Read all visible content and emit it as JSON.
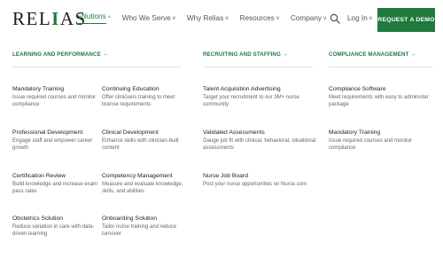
{
  "logo": {
    "text_left": "REL",
    "text_accent": "I",
    "text_right": "AS"
  },
  "nav": [
    {
      "label": "Solutions",
      "chevron": "^",
      "active": true
    },
    {
      "label": "Who We Serve",
      "chevron": "v"
    },
    {
      "label": "Why Relias",
      "chevron": "v"
    },
    {
      "label": "Resources",
      "chevron": "v"
    },
    {
      "label": "Company",
      "chevron": "v"
    }
  ],
  "header": {
    "search_icon": "search-icon",
    "login_label": "Log In",
    "login_chevron": "v",
    "cta_label": "REQUEST A DEMO"
  },
  "colors": {
    "brand_green": "#1f7a3d"
  },
  "sections": [
    {
      "heading": "LEARNING AND PERFORMANCE →"
    },
    {
      "heading": "RECRUITING AND STAFFING →"
    },
    {
      "heading": "COMPLIANCE MANAGEMENT →"
    }
  ],
  "items": [
    {
      "title": "Mandatory Training",
      "desc": "Issue required courses and monitor compliance"
    },
    {
      "title": "Continuing Education",
      "desc": "Offer clinicians training to meet license requirements"
    },
    {
      "title": "Professional Development",
      "desc": "Engage staff and empower career growth"
    },
    {
      "title": "Clinical Development",
      "desc": "Enhance skills with clinician-built content"
    },
    {
      "title": "Certification Review",
      "desc": "Build knowledge and increase exam pass rates"
    },
    {
      "title": "Competency Management",
      "desc": "Measure and evaluate knowledge, skills, and abilities"
    },
    {
      "title": "Obstetrics Solution",
      "desc": "Reduce variation in care with data-driven learning"
    },
    {
      "title": "Onboarding Solution",
      "desc": "Tailor nurse training and reduce turnover"
    },
    {
      "title": "Talent Acquisition Advertising",
      "desc": "Target your recruitment to our 3M+ nurse community"
    },
    {
      "title": "Validated Assessments",
      "desc": "Gauge job fit with clinical, behavioral, situational assessments"
    },
    {
      "title": "Nurse Job Board",
      "desc": "Post your nurse opportunities on Nurse.com"
    },
    {
      "title": "Compliance Software",
      "desc": "Meet requirements with easy to administer package"
    },
    {
      "title": "Mandatory Training",
      "desc": "Issue required courses and monitor compliance"
    }
  ]
}
